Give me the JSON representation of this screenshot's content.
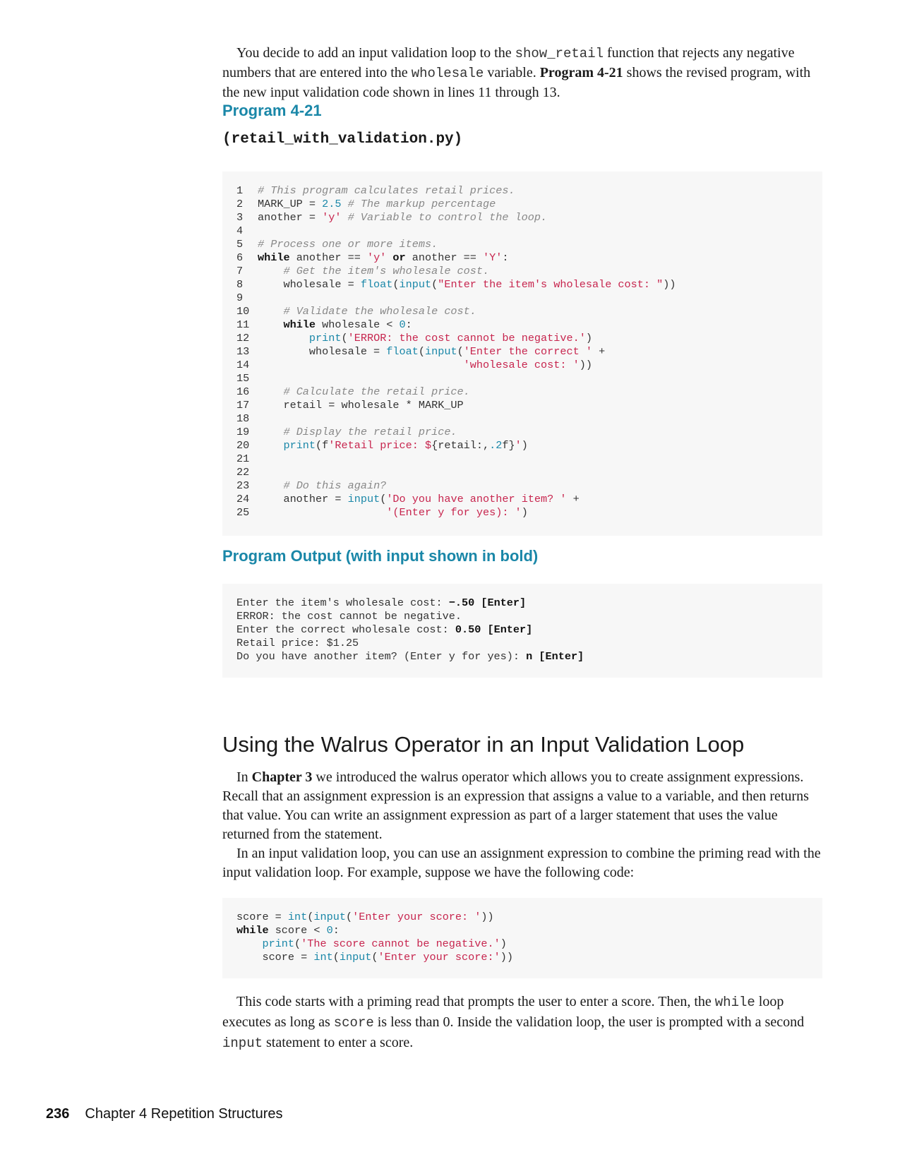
{
  "intro": {
    "t1": "You decide to add an input validation loop to the ",
    "c1": "show_retail",
    "t2": " function that rejects any negative numbers that are entered into the ",
    "c2": "wholesale",
    "t3": " variable. ",
    "b1": "Program 4-21",
    "t4": " shows the revised program, with the new input validation code shown in lines 11 through 13."
  },
  "program": {
    "heading": "Program 4-21",
    "filename": "(retail_with_validation.py)"
  },
  "output": {
    "heading": "Program Output (with input shown in bold)"
  },
  "section": {
    "title": "Using the Walrus Operator in an Input Validation Loop",
    "p1_a": "In ",
    "p1_b": "Chapter 3",
    "p1_c": " we introduced the walrus operator which allows you to create assignment expressions. Recall that an assignment expression is an expression that assigns a value to a variable, and then returns that value. You can write an assignment expression as part of a larger statement that uses the value returned from the statement.",
    "p2": "In an input validation loop, you can use an assignment expression to combine the priming read with the input validation loop. For example, suppose we have the following code:",
    "p3_a": "This code starts with a priming read that prompts the user to enter a score. Then, the ",
    "p3_c1": "while",
    "p3_b": " loop executes as long as ",
    "p3_c2": "score",
    "p3_c": " is less than 0. Inside the validation loop, the user is prompted with a second ",
    "p3_c3": "input",
    "p3_d": " statement to enter a score."
  },
  "footer": {
    "page_number": "236",
    "chapter": "Chapter 4 Repetition Structures"
  }
}
